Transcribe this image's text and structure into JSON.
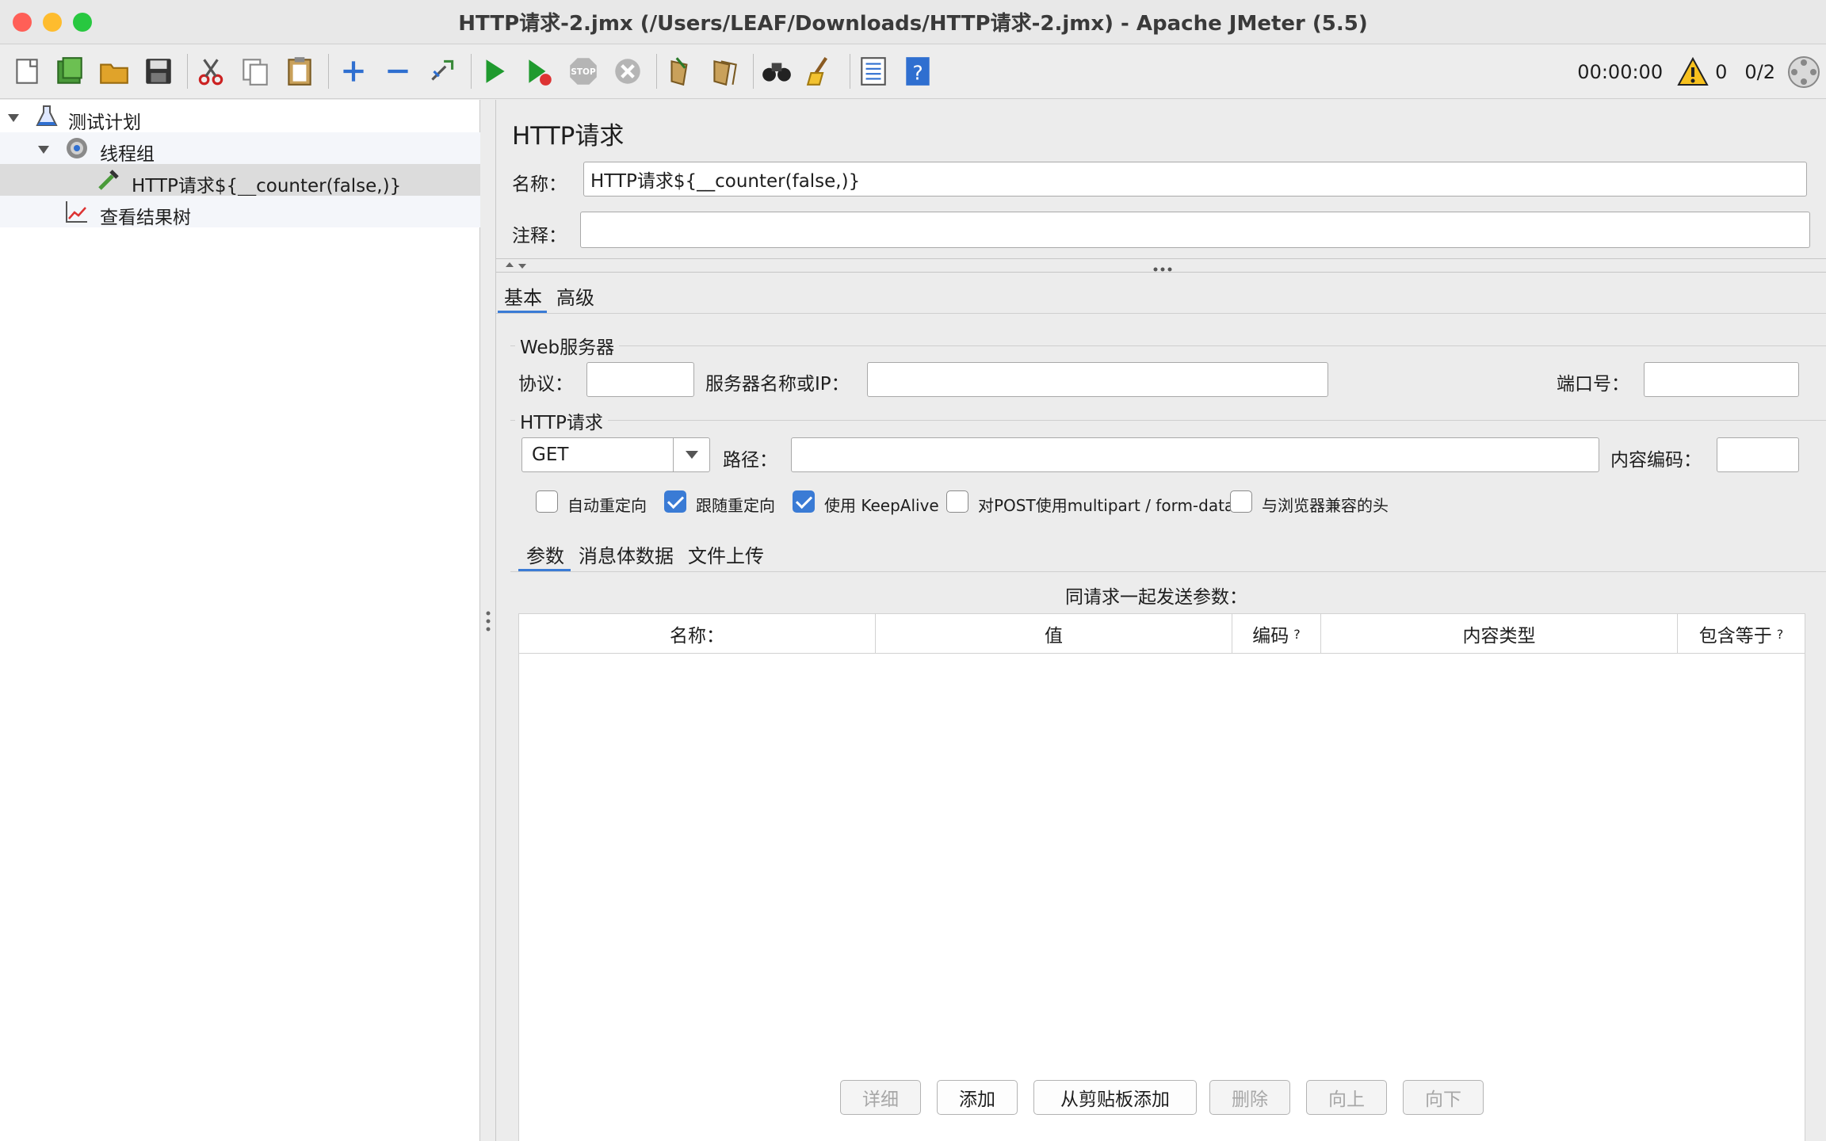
{
  "window": {
    "title": "HTTP请求-2.jmx (/Users/LEAF/Downloads/HTTP请求-2.jmx) - Apache JMeter (5.5)"
  },
  "toolbar": {
    "icons": [
      "new-icon",
      "templates-icon",
      "open-icon",
      "save-icon",
      "cut-icon",
      "copy-icon",
      "paste-icon",
      "expand-icon",
      "collapse-icon",
      "toggle-icon",
      "start-icon",
      "start-no-pause-icon",
      "stop-icon",
      "shutdown-icon",
      "clear-icon",
      "clear-all-icon",
      "search-icon",
      "reset-search-icon",
      "function-helper-icon",
      "help-icon"
    ],
    "timer": "00:00:00",
    "warning_count": "0",
    "threads": "0/2"
  },
  "tree": {
    "items": [
      {
        "label": "测试计划"
      },
      {
        "label": "线程组"
      },
      {
        "label": "HTTP请求${__counter(false,)}"
      },
      {
        "label": "查看结果树"
      }
    ]
  },
  "panel": {
    "title": "HTTP请求",
    "name_label": "名称：",
    "name_value": "HTTP请求${__counter(false,)}",
    "comment_label": "注释：",
    "comment_value": "",
    "tabs": [
      "基本",
      "高级"
    ],
    "web_server": {
      "group_label": "Web服务器",
      "protocol_label": "协议：",
      "protocol_value": "",
      "server_label": "服务器名称或IP：",
      "server_value": "",
      "port_label": "端口号：",
      "port_value": ""
    },
    "http_request": {
      "group_label": "HTTP请求",
      "method": "GET",
      "path_label": "路径：",
      "path_value": "",
      "encoding_label": "内容编码：",
      "encoding_value": ""
    },
    "checkboxes": [
      {
        "label": "自动重定向",
        "checked": false
      },
      {
        "label": "跟随重定向",
        "checked": true
      },
      {
        "label": "使用 KeepAlive",
        "checked": true
      },
      {
        "label": "对POST使用multipart / form-data",
        "checked": false
      },
      {
        "label": "与浏览器兼容的头",
        "checked": false
      }
    ],
    "sub_tabs": [
      "参数",
      "消息体数据",
      "文件上传"
    ],
    "params_caption": "同请求一起发送参数：",
    "columns": [
      "名称：",
      "值",
      "编码",
      "内容类型",
      "包含等于"
    ],
    "help_mark": "?",
    "buttons": [
      {
        "label": "详细",
        "enabled": false
      },
      {
        "label": "添加",
        "enabled": true
      },
      {
        "label": "从剪贴板添加",
        "enabled": true
      },
      {
        "label": "删除",
        "enabled": false
      },
      {
        "label": "向上",
        "enabled": false
      },
      {
        "label": "向下",
        "enabled": false
      }
    ]
  },
  "colors": {
    "accent": "#3a7bd5",
    "selected_row": "#dcdcdc",
    "close": "#ff5f57",
    "minimize": "#febc2e",
    "zoom": "#28c840"
  }
}
